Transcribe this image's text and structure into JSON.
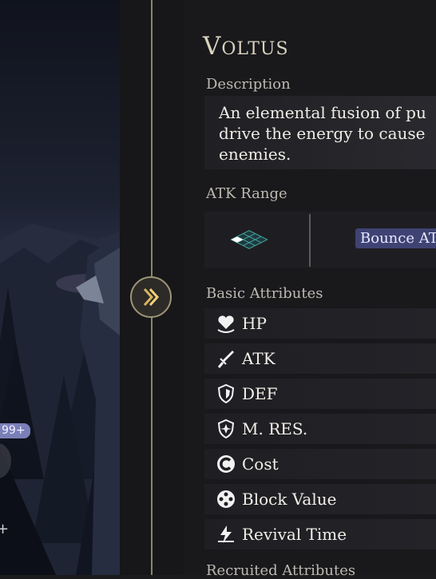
{
  "operator": {
    "name": "Voltus"
  },
  "description": {
    "label": "Description",
    "text_lines": [
      "An elemental fusion of pu",
      "drive the energy to cause",
      "enemies."
    ]
  },
  "atk_range": {
    "label": "ATK Range",
    "chip": "Bounce AT"
  },
  "basic_attributes": {
    "label": "Basic Attributes",
    "items": [
      {
        "label": "HP",
        "icon": "heart-icon"
      },
      {
        "label": "ATK",
        "icon": "sword-icon"
      },
      {
        "label": "DEF",
        "icon": "shield-icon"
      },
      {
        "label": "M. RES.",
        "icon": "magic-shield-icon"
      },
      {
        "label": "Cost",
        "icon": "cost-icon"
      },
      {
        "label": "Block Value",
        "icon": "block-icon"
      },
      {
        "label": "Revival Time",
        "icon": "revival-icon"
      }
    ]
  },
  "next_section_label": "Recruited Attributes",
  "left_panel": {
    "badge": "99+",
    "side_glyph": "+"
  },
  "colors": {
    "accent_gold": "#9e9477",
    "chip_bg": "#3f4373",
    "badge_bg": "#7a7fb8"
  }
}
